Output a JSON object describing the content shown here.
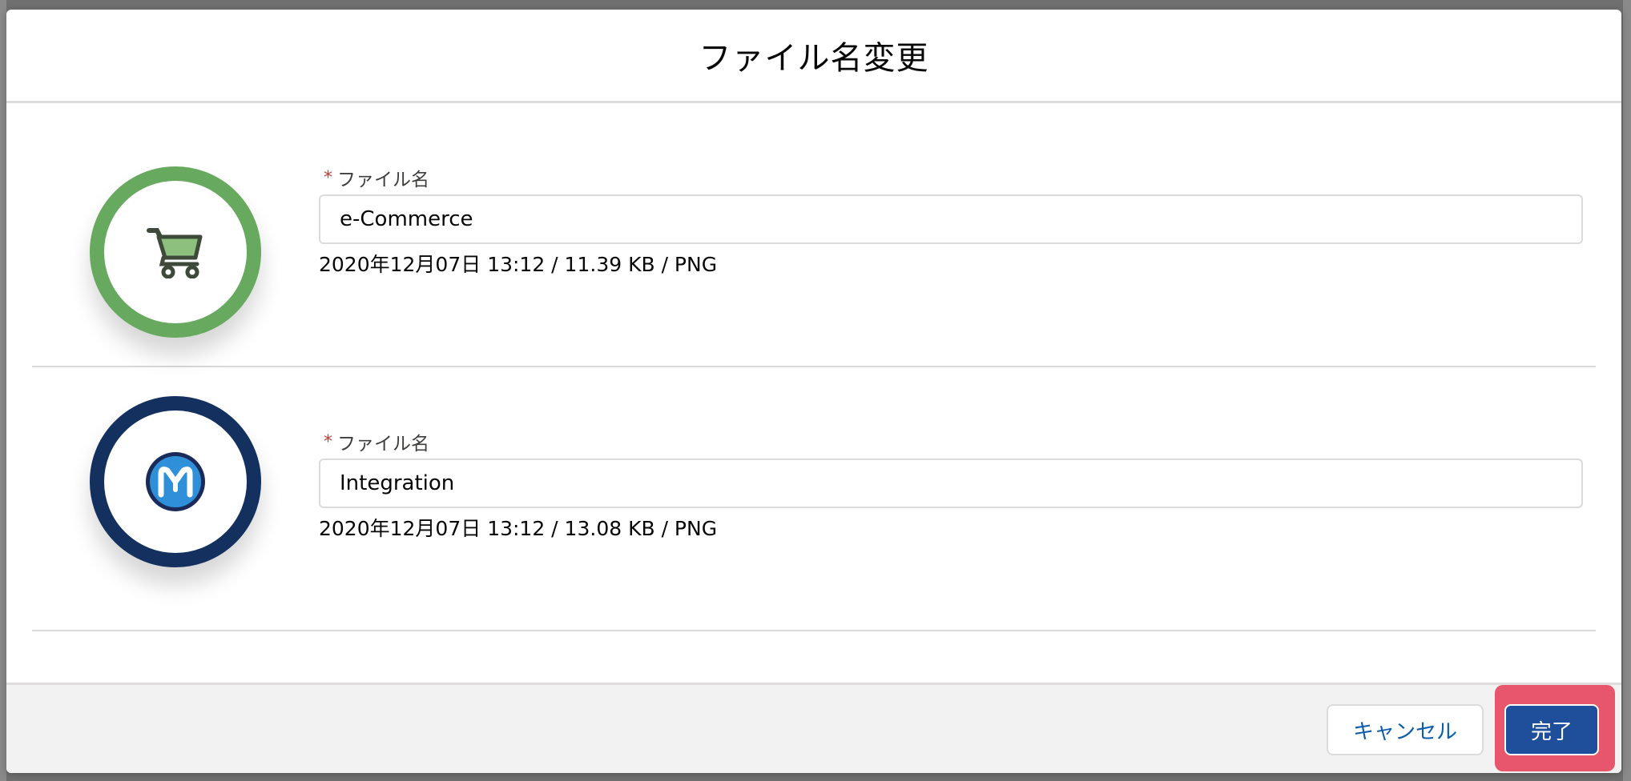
{
  "modal": {
    "title": "ファイル名変更"
  },
  "files": [
    {
      "label": "ファイル名",
      "required_mark": "*",
      "value": "e-Commerce",
      "meta": "2020年12月07日 13:12 / 11.39 KB / PNG",
      "icon": "shopping-cart-icon",
      "ring_color": "#67a95e"
    },
    {
      "label": "ファイル名",
      "required_mark": "*",
      "value": "Integration",
      "meta": "2020年12月07日 13:12 / 13.08 KB / PNG",
      "icon": "mulesoft-logo-icon",
      "ring_color": "#13305f"
    }
  ],
  "footer": {
    "cancel_label": "キャンセル",
    "done_label": "完了",
    "highlight_color": "#e8566b",
    "primary_color": "#1f4f9b"
  }
}
